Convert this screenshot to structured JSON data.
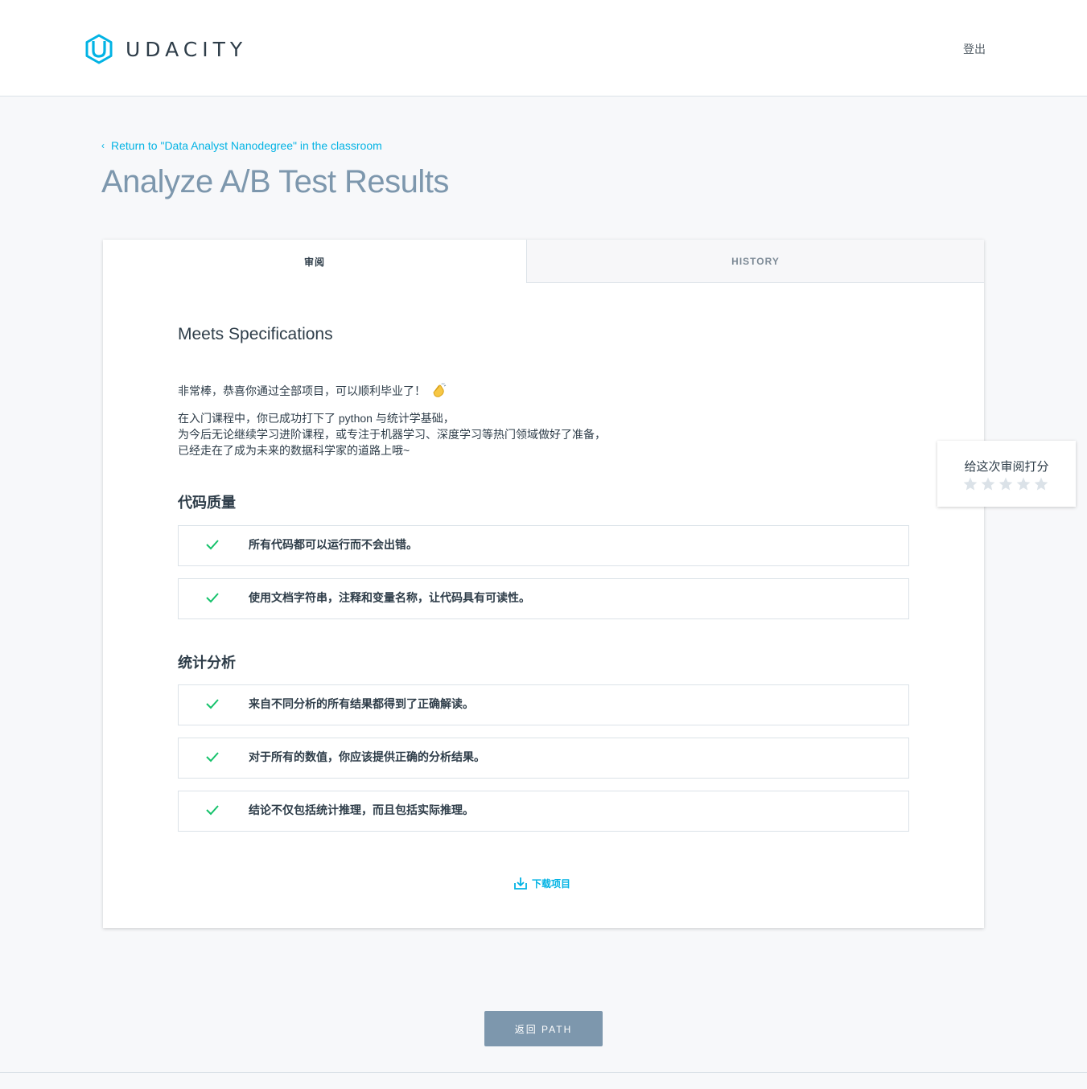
{
  "header": {
    "logo_text": "UDACITY",
    "logout": "登出"
  },
  "breadcrumb": {
    "back_label": "Return to \"Data Analyst Nanodegree\" in the classroom"
  },
  "page_title": "Analyze A/B Test Results",
  "tabs": [
    {
      "label": "审阅",
      "active": true
    },
    {
      "label": "HISTORY",
      "active": false
    }
  ],
  "review": {
    "result": "Meets Specifications",
    "congrats": "非常棒，恭喜你通过全部项目，可以顺利毕业了！",
    "message_lines": [
      "在入门课程中，你已成功打下了 python 与统计学基础，",
      "为今后无论继续学习进阶课程，或专注于机器学习、深度学习等热门领域做好了准备，",
      "已经走在了成为未来的数据科学家的道路上哦~"
    ],
    "sections": [
      {
        "title": "代码质量",
        "items": [
          "所有代码都可以运行而不会出错。",
          "使用文档字符串，注释和变量名称，让代码具有可读性。"
        ]
      },
      {
        "title": "统计分析",
        "items": [
          "来自不同分析的所有结果都得到了正确解读。",
          "对于所有的数值，你应该提供正确的分析结果。",
          "结论不仅包括统计推理，而且包括实际推理。"
        ]
      }
    ],
    "download_label": "下载项目"
  },
  "rating": {
    "label": "给这次审阅打分",
    "stars": 5,
    "selected": 0
  },
  "return_button": "返回 PATH",
  "colors": {
    "accent": "#02b3e4",
    "check": "#15c26b",
    "title": "#7d97ad",
    "button": "#7d97ad"
  }
}
